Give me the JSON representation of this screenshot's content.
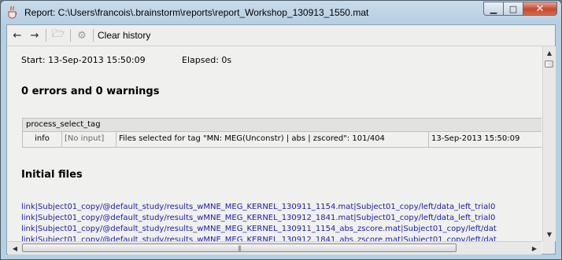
{
  "window": {
    "title": "Report: C:\\Users\\francois\\.brainstorm\\reports\\report_Workshop_130913_1550.mat",
    "icon": "java-cup-icon",
    "minimize_glyph": "▁",
    "maximize_glyph": "□",
    "close_glyph": "✕"
  },
  "toolbar": {
    "back_glyph": "←",
    "forward_glyph": "→",
    "open_glyph": "🗁",
    "settings_glyph": "⚙",
    "clear_label": "Clear history"
  },
  "report": {
    "start": "Start: 13-Sep-2013 15:50:09",
    "elapsed": "Elapsed: 0s",
    "errors_heading": "0 errors and 0 warnings",
    "process": {
      "name": "process_select_tag",
      "rows": [
        {
          "level": "info",
          "input": "[No input]",
          "message": "Files selected for tag \"MN: MEG(Unconstr) | abs | zscored\": 101/404",
          "time": "13-Sep-2013 15:50:09"
        }
      ]
    },
    "initial_heading": "Initial files",
    "links": [
      "link|Subject01_copy/@default_study/results_wMNE_MEG_KERNEL_130911_1154.mat|Subject01_copy/left/data_left_trial0",
      "link|Subject01_copy/@default_study/results_wMNE_MEG_KERNEL_130912_1841.mat|Subject01_copy/left/data_left_trial0",
      "link|Subject01_copy/@default_study/results_wMNE_MEG_KERNEL_130911_1154_abs_zscore.mat|Subject01_copy/left/dat",
      "link|Subject01_copy/@default_study/results_wMNE_MEG_KERNEL_130912_1841_abs_zscore.mat|Subject01_copy/left/dat"
    ]
  },
  "scrollbars": {
    "up_glyph": "▲",
    "down_glyph": "▼",
    "left_glyph": "◀",
    "right_glyph": "▶",
    "grip": "|||"
  },
  "colors": {
    "link": "#1c1caa",
    "title_bar": "#b7cfe2",
    "close_button": "#c8462c"
  }
}
